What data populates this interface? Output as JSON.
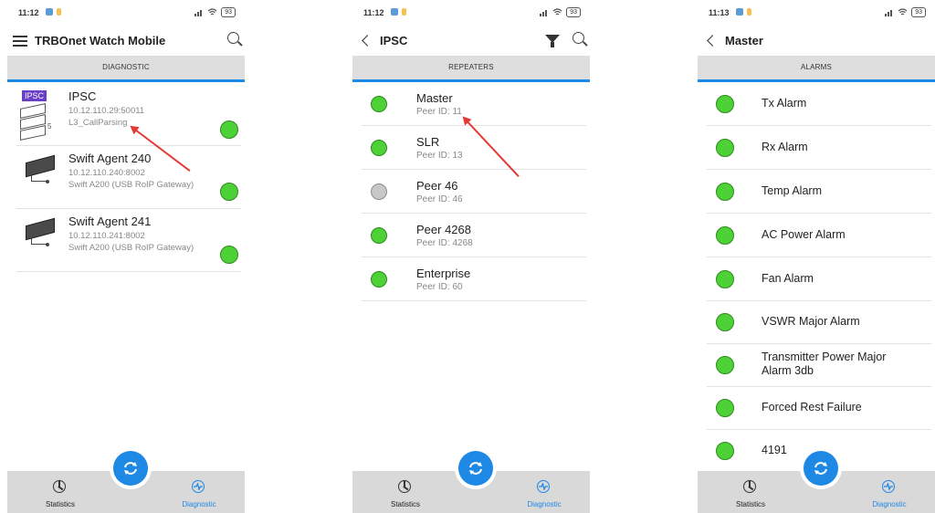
{
  "screen1": {
    "time": "11:12",
    "battery": "93",
    "title": "TRBOnet Watch Mobile",
    "section": "DIAGNOSTIC",
    "items": [
      {
        "badge": "IPSC",
        "name": "IPSC",
        "line1": "10.12.110.29:50011",
        "line2": "L3_CallParsing",
        "count": "5",
        "status": "green"
      },
      {
        "name": "Swift Agent 240",
        "line1": "10.12.110.240:8002",
        "line2": "Swift A200 (USB RoIP Gateway)",
        "status": "green"
      },
      {
        "name": "Swift Agent 241",
        "line1": "10.12.110.241:8002",
        "line2": "Swift A200 (USB RoIP Gateway)",
        "status": "green"
      }
    ],
    "tabs": {
      "statistics": "Statistics",
      "diagnostic": "Diagnostic"
    }
  },
  "screen2": {
    "time": "11:12",
    "battery": "93",
    "title": "IPSC",
    "section": "REPEATERS",
    "items": [
      {
        "name": "Master",
        "peer": "Peer ID: 11",
        "status": "green"
      },
      {
        "name": "SLR",
        "peer": "Peer ID: 13",
        "status": "green"
      },
      {
        "name": "Peer 46",
        "peer": "Peer ID: 46",
        "status": "grey"
      },
      {
        "name": "Peer 4268",
        "peer": "Peer ID: 4268",
        "status": "green"
      },
      {
        "name": "Enterprise",
        "peer": "Peer ID: 60",
        "status": "green"
      }
    ],
    "tabs": {
      "statistics": "Statistics",
      "diagnostic": "Diagnostic"
    }
  },
  "screen3": {
    "time": "11:13",
    "battery": "93",
    "title": "Master",
    "section": "ALARMS",
    "items": [
      {
        "name": "Tx Alarm",
        "status": "green"
      },
      {
        "name": "Rx Alarm",
        "status": "green"
      },
      {
        "name": "Temp Alarm",
        "status": "green"
      },
      {
        "name": "AC Power Alarm",
        "status": "green"
      },
      {
        "name": "Fan Alarm",
        "status": "green"
      },
      {
        "name": "VSWR Major Alarm",
        "status": "green"
      },
      {
        "name": "Transmitter Power Major Alarm 3db",
        "status": "green"
      },
      {
        "name": "Forced Rest Failure",
        "status": "green"
      },
      {
        "name": "4191",
        "status": "green"
      }
    ],
    "tabs": {
      "statistics": "Statistics",
      "diagnostic": "Diagnostic"
    }
  },
  "colors": {
    "accent": "#1e88e5",
    "status_ok": "#4cd137",
    "status_off": "#c8c8c8",
    "annotation": "#e53935",
    "ipsc_badge": "#6a3fc7"
  }
}
